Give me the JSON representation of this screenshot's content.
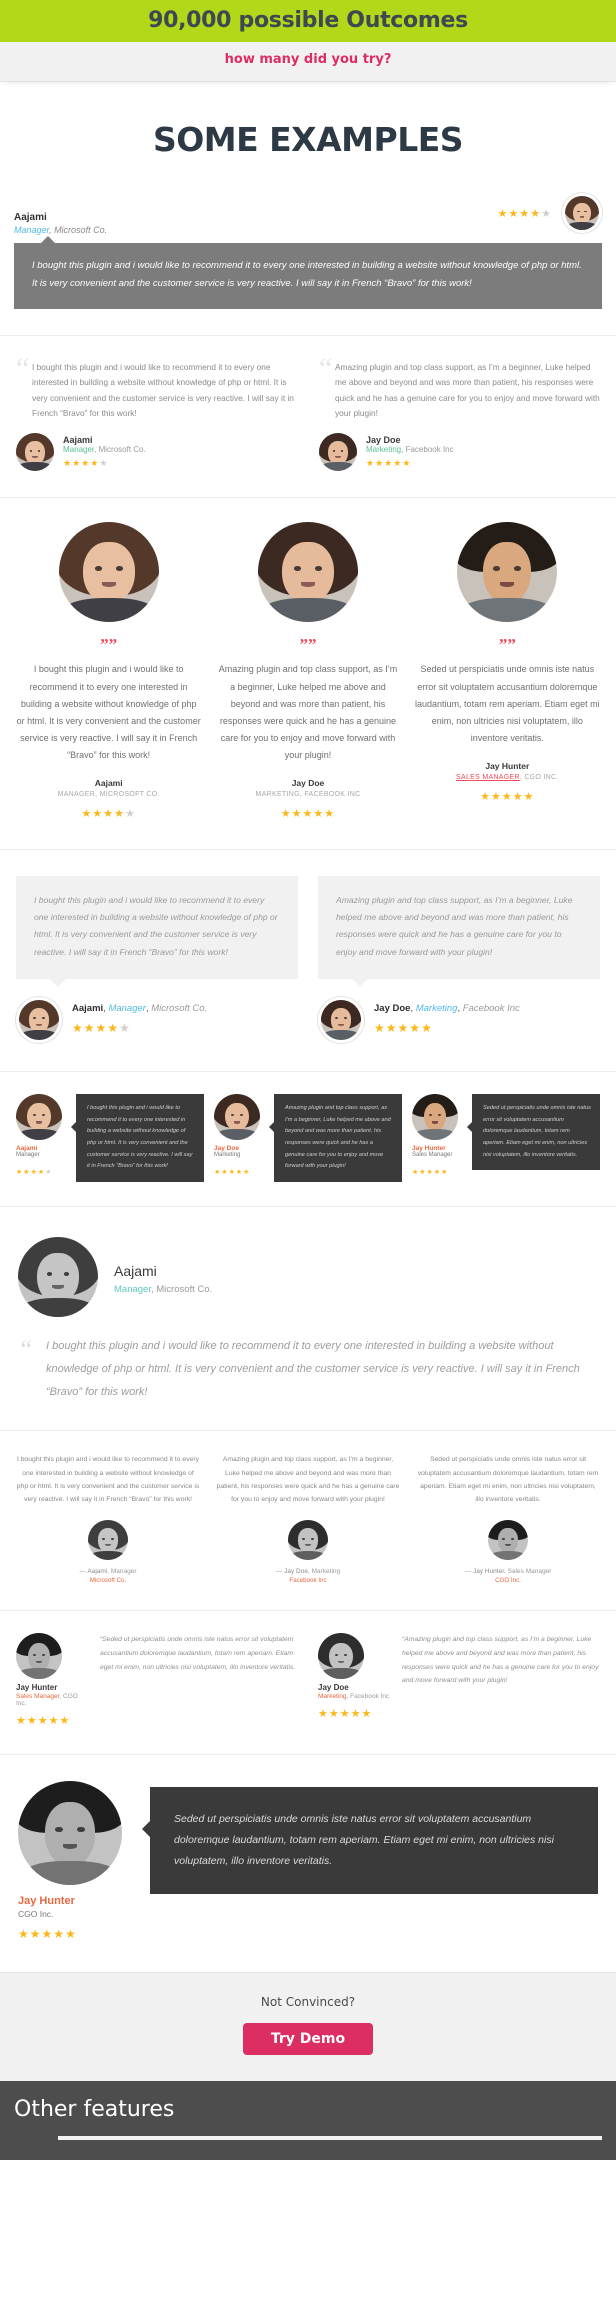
{
  "header": {
    "title": "90,000 possible Outcomes",
    "subtitle": "how many did you try?",
    "green": "#b2d819",
    "pink": "#dd2e63"
  },
  "section": {
    "title": "SOME EXAMPLES"
  },
  "quotes": {
    "aajami": "I bought this plugin and i would like to recommend it to every one interested in building a website without knowledge of php or html. It is very convenient and the customer service is very reactive. I will say it in French “Bravo” for this work!",
    "jaydoe": "Amazing plugin and top class support, as I’m a beginner, Luke helped me above and beyond and was more than patient, his responses were quick and he has a genuine care for you to enjoy and move forward with your plugin!",
    "jayhunter": "Seded ut perspiciatis unde omnis iste natus error sit voluptatem accusantium doloremque laudantium, totam rem aperiam. Etiam eget mi enim, non ultricies nisi voluptatem, illo inventore veritatis."
  },
  "people": {
    "aajami": {
      "name": "Aajami",
      "role": "Manager",
      "company": "Microsoft Co.",
      "role_caps": "MANAGER",
      "company_caps": "MICROSOFT CO.",
      "rating": 4
    },
    "jaydoe": {
      "name": "Jay Doe",
      "role": "Marketing",
      "company": "Facebook Inc",
      "role_caps": "MARKETING",
      "company_caps": "FACEBOOK INC",
      "rating": 5
    },
    "jayhunter": {
      "name": "Jay Hunter",
      "role": "Sales Manager",
      "company": "CGO Inc.",
      "role_caps": "SALES MANAGER",
      "company_caps": "CGO INC.",
      "rating": 5
    }
  },
  "punct": {
    "comma": ",",
    "quote_open": "“",
    "quote_mark": "””",
    "serif_quote": "“",
    "dash": "—"
  },
  "cta": {
    "text": "Not Convinced?",
    "button": "Try Demo"
  },
  "footer": {
    "title": "Other features"
  }
}
